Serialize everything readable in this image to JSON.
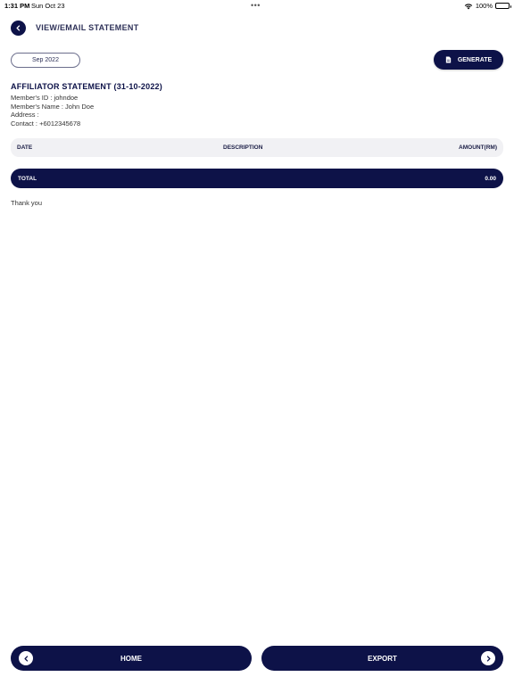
{
  "status_bar": {
    "time": "1:31 PM",
    "date": "Sun Oct 23",
    "dots": "•••",
    "battery": "100%"
  },
  "header": {
    "title": "VIEW/EMAIL STATEMENT"
  },
  "controls": {
    "month": "Sep 2022",
    "generate_label": "GENERATE"
  },
  "statement": {
    "title": "AFFILIATOR STATEMENT (31-10-2022)",
    "member_id": "Member's ID : johndoe",
    "member_name": "Member's Name : John Doe",
    "address": "Address :",
    "contact": "Contact : +6012345678"
  },
  "table": {
    "columns": [
      "DATE",
      "DESCRIPTION",
      "AMOUNT(RM)"
    ],
    "rows": [],
    "total_label": "TOTAL",
    "total_value": "0.00"
  },
  "footer_note": "Thank you",
  "footer": {
    "home_label": "HOME",
    "export_label": "EXPORT"
  },
  "colors": {
    "primary": "#0d1248",
    "table_header_bg": "#f1f1f4"
  }
}
